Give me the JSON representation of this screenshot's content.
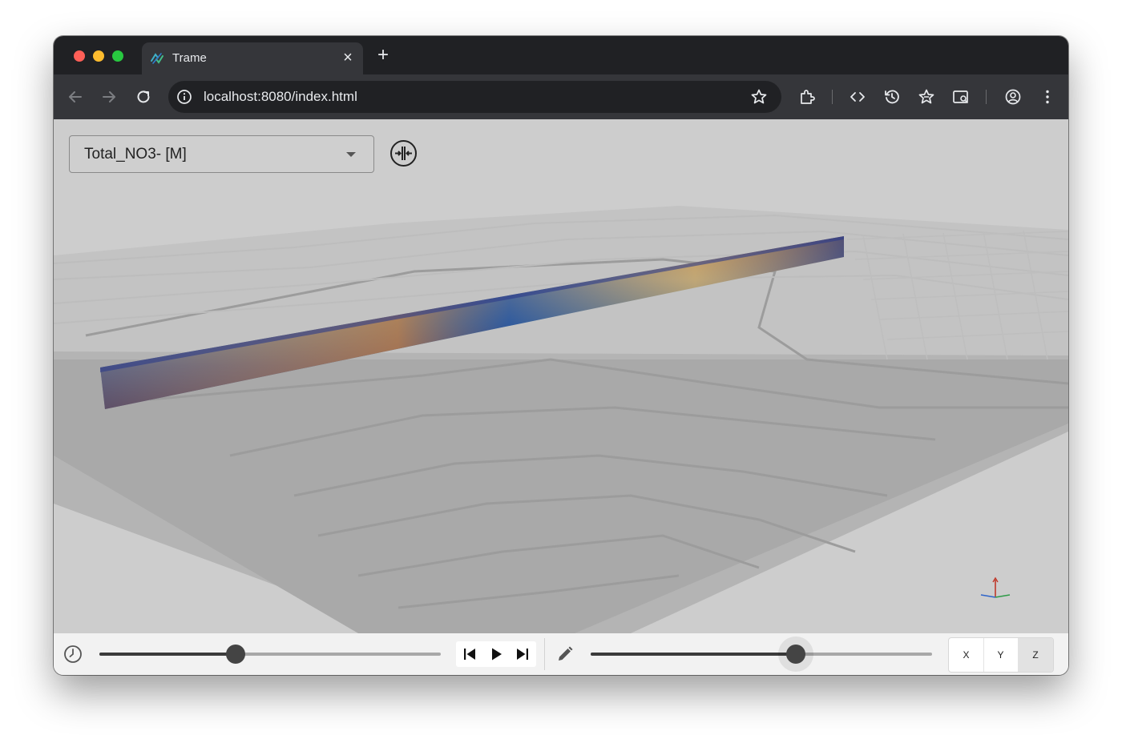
{
  "browser": {
    "tab": {
      "title": "Trame",
      "close_label": "×",
      "icon": "trame-logo-icon"
    },
    "new_tab_label": "+",
    "address": {
      "url": "localhost:8080/index.html"
    },
    "toolbar_icons": [
      "back-icon",
      "forward-icon",
      "reload-icon",
      "site-info-icon",
      "bookmark-star-icon",
      "extensions-icon",
      "code-icon",
      "history-icon",
      "reading-list-icon",
      "tab-search-icon",
      "profile-icon",
      "menu-icon"
    ]
  },
  "app": {
    "field_select": {
      "value": "Total_NO3- [M]"
    },
    "reset_camera_icon": "reset-camera-icon",
    "time_control": {
      "icon": "clock-icon",
      "slider_fraction": 0.4,
      "controls": [
        "first-frame-icon",
        "play-icon",
        "last-frame-icon"
      ]
    },
    "scale_control": {
      "icon": "pencil-icon",
      "slider_fraction": 0.6
    },
    "view_buttons": [
      {
        "label": "X",
        "active": false
      },
      {
        "label": "Y",
        "active": false
      },
      {
        "label": "Z",
        "active": true
      }
    ]
  },
  "colors": {
    "titlebar": "#202124",
    "toolbar": "#35363a",
    "viewport": "#cdcdcd",
    "bottom_bar": "#f2f2f2",
    "colormap": [
      "#1b2166",
      "#2c55a0",
      "#5aa0c0",
      "#cfd3a0",
      "#c98a4a",
      "#9a5b2b"
    ]
  }
}
